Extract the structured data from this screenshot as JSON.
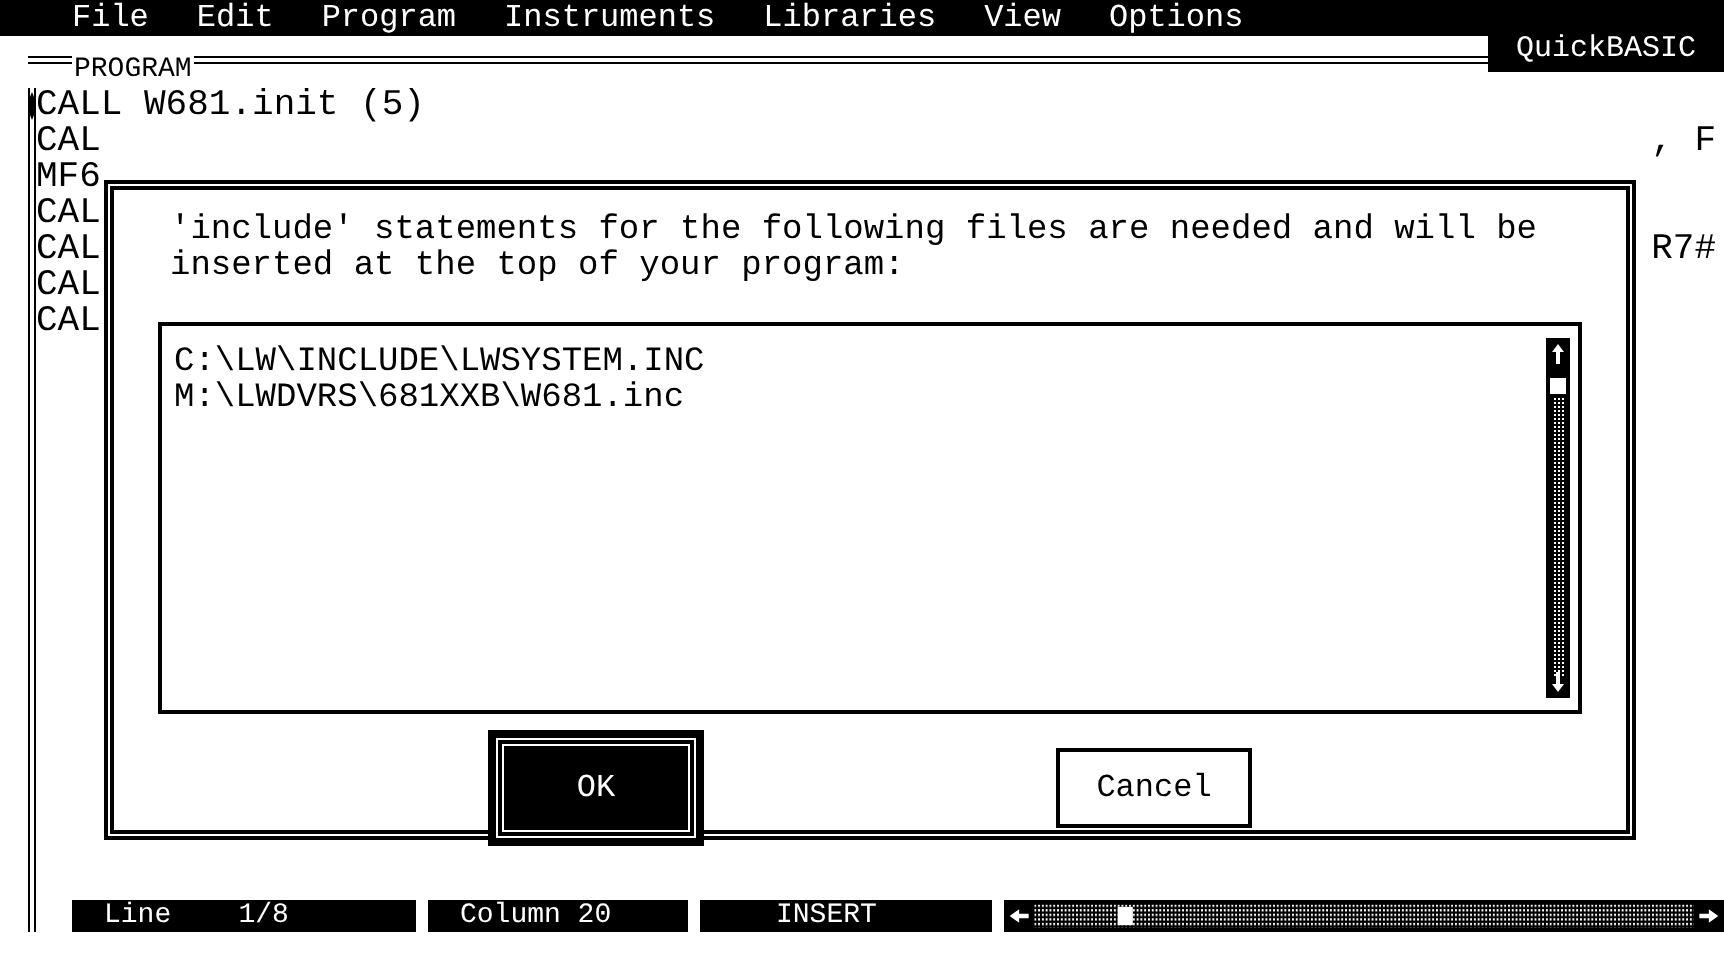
{
  "menu": [
    "File",
    "Edit",
    "Program",
    "Instruments",
    "Libraries",
    "View",
    "Options"
  ],
  "editor": {
    "title": "PROGRAM",
    "mode_label": "QuickBASIC",
    "lines": [
      {
        "text": "CALL W681.init (5)"
      },
      {
        "text": "CAL",
        "tail": ", F"
      },
      {
        "text": "MF6"
      },
      {
        "text": "CAL"
      },
      {
        "text": "CAL",
        "tail": "R7#"
      },
      {
        "text": "CAL"
      },
      {
        "text": "CAL"
      }
    ]
  },
  "dialog": {
    "message": "'include' statements for the following files are needed and will be inserted at the top of your program:",
    "files": [
      "C:\\LW\\INCLUDE\\LWSYSTEM.INC",
      "M:\\LWDVRS\\681XXB\\W681.inc"
    ],
    "buttons": [
      {
        "label": "OK",
        "selected": true
      },
      {
        "label": "Cancel",
        "selected": false
      }
    ]
  },
  "status_bar": {
    "line_label": "Line",
    "line_value": "1/8",
    "column": "Column 20",
    "mode": "INSERT"
  }
}
